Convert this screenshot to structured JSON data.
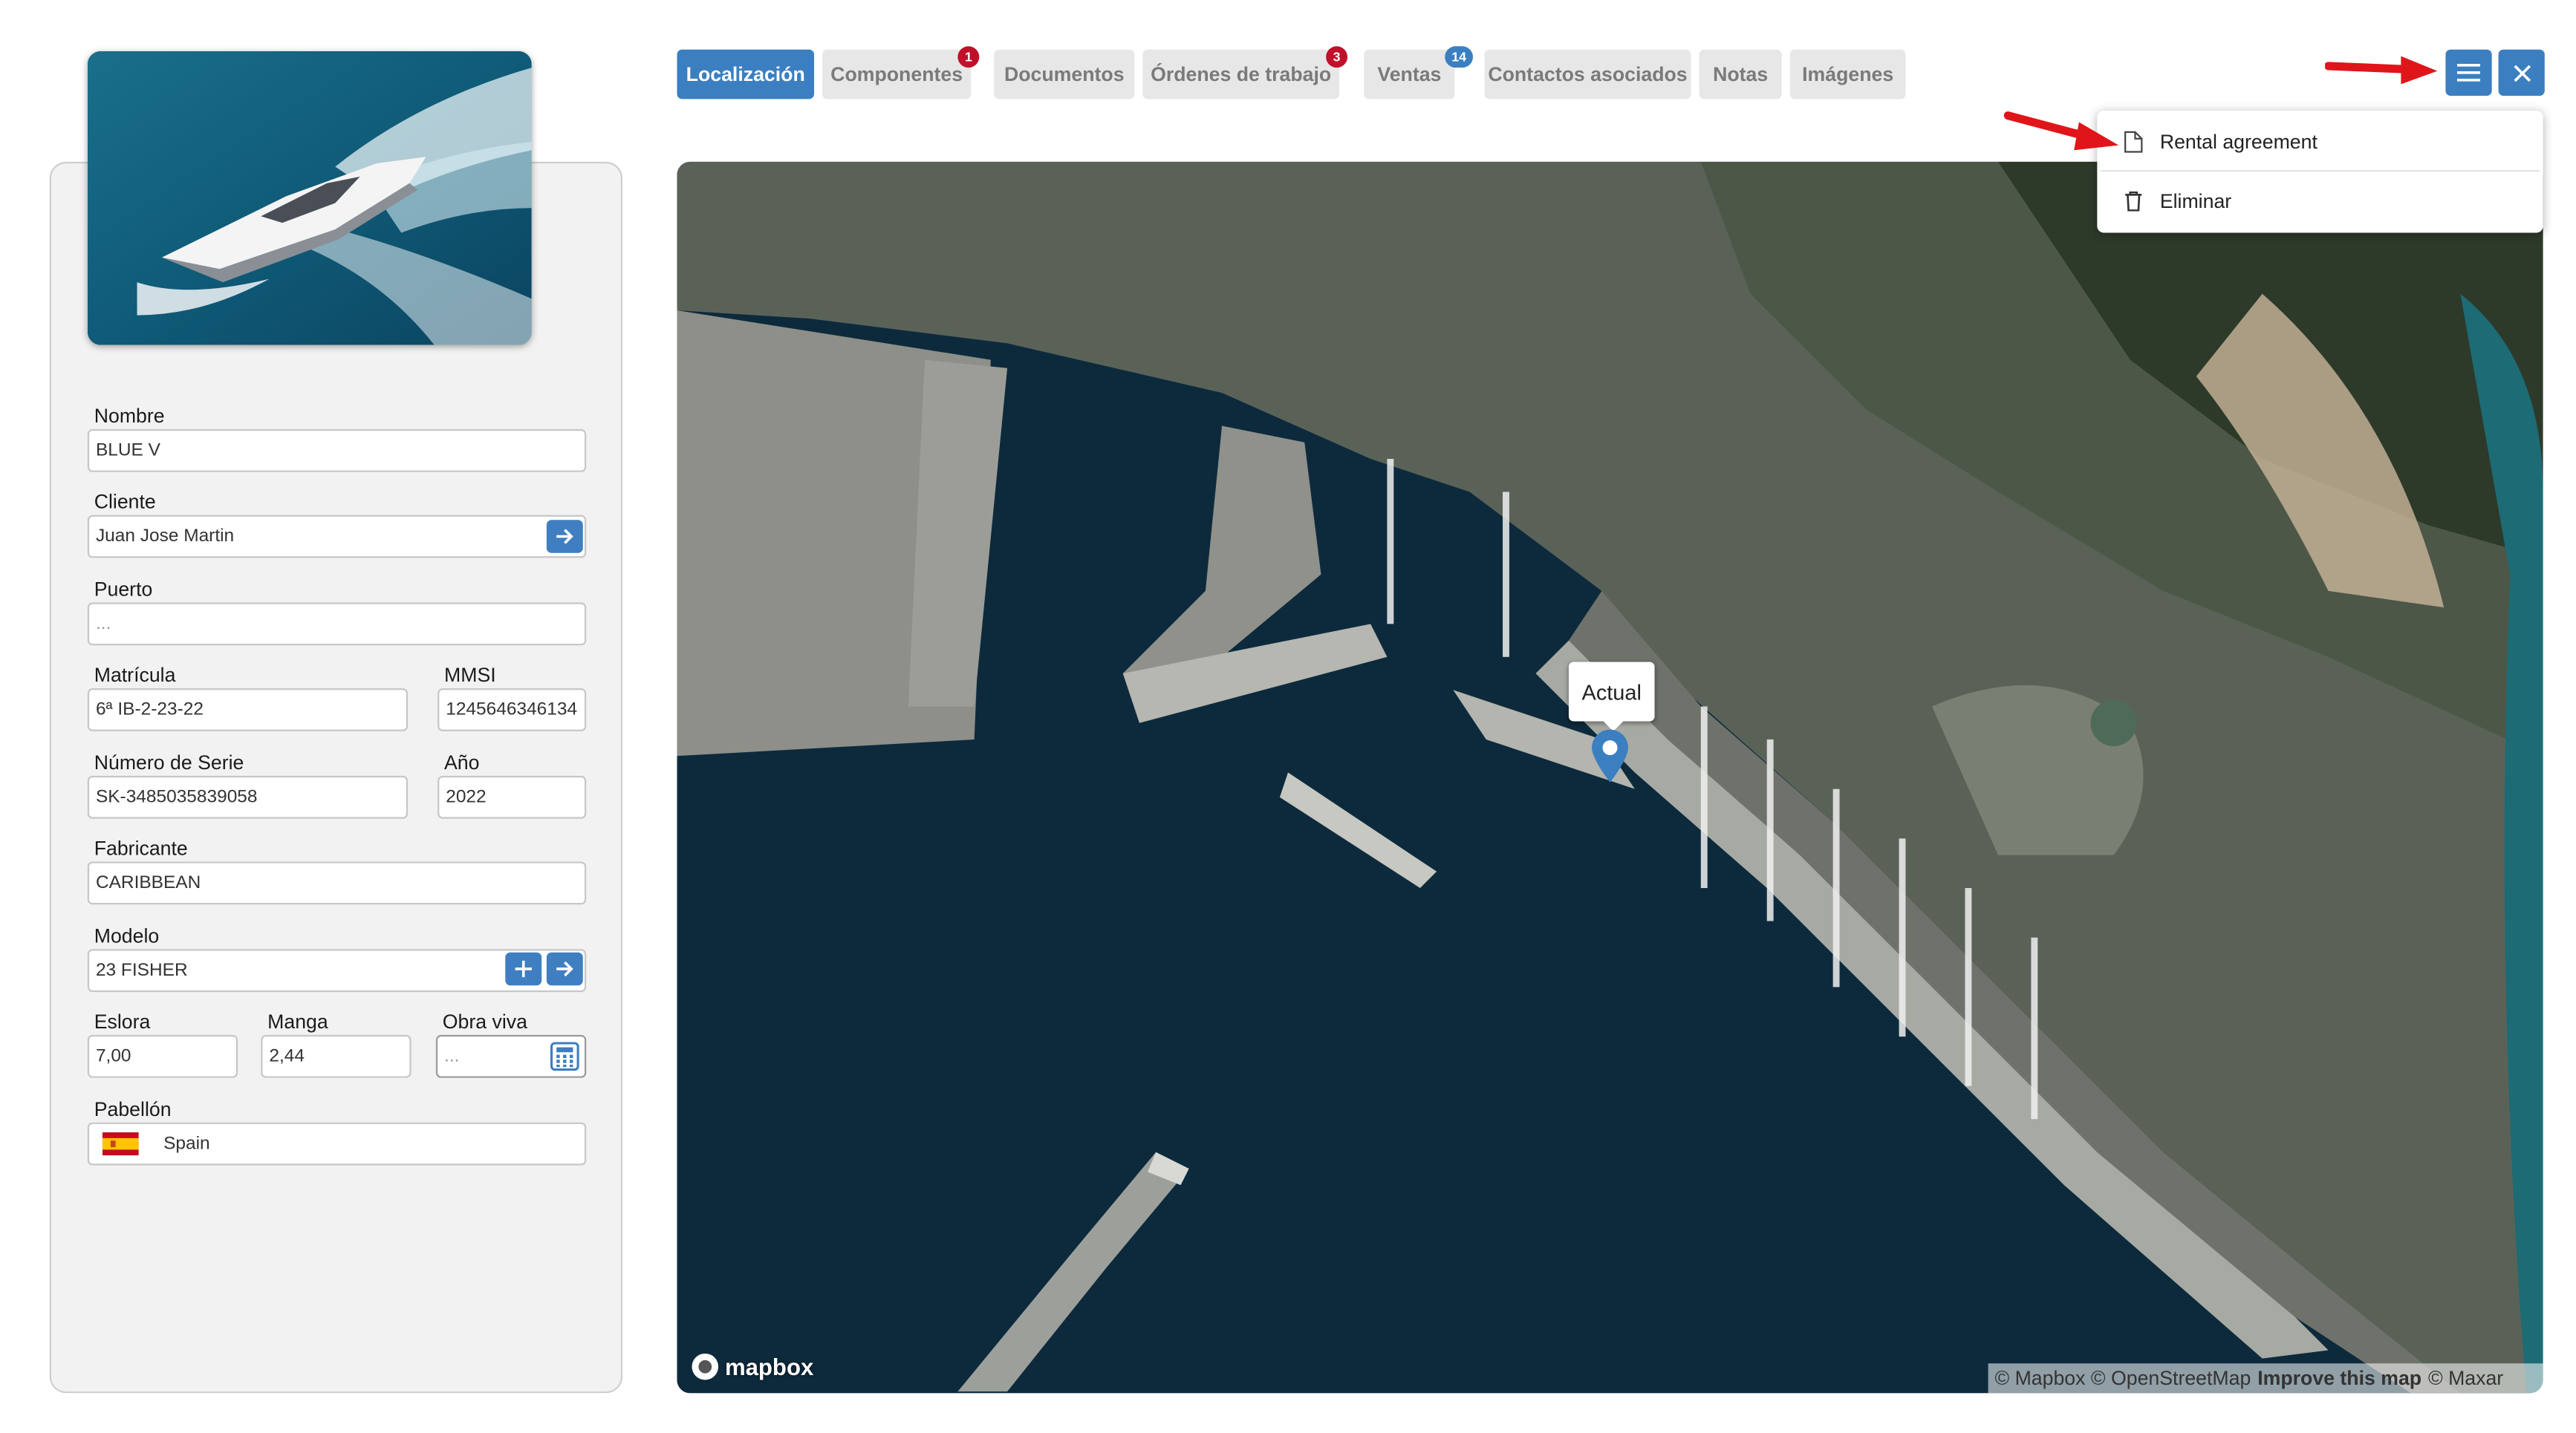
{
  "colors": {
    "accent": "#3c7fc1",
    "badge_red": "#c0102a",
    "annotation_arrow": "#e0151a"
  },
  "tabs": [
    {
      "label": "Localización",
      "active": true
    },
    {
      "label": "Componentes",
      "badge": "1",
      "badge_color": "red"
    },
    {
      "label": "Documentos"
    },
    {
      "label": "Órdenes de trabajo",
      "badge": "3",
      "badge_color": "red"
    },
    {
      "label": "Ventas",
      "badge": "14",
      "badge_color": "blue"
    },
    {
      "label": "Contactos asociados"
    },
    {
      "label": "Notas"
    },
    {
      "label": "Imágenes"
    }
  ],
  "toolbar": {
    "menu_icon": "hamburger-menu-icon",
    "close_icon": "close-icon"
  },
  "dropdown": {
    "items": [
      {
        "label": "Rental agreement",
        "icon": "document-icon"
      },
      {
        "label": "Eliminar",
        "icon": "trash-icon"
      }
    ]
  },
  "form": {
    "nombre": {
      "label": "Nombre",
      "value": "BLUE V"
    },
    "cliente": {
      "label": "Cliente",
      "value": "Juan Jose Martin"
    },
    "puerto": {
      "label": "Puerto",
      "placeholder": "..."
    },
    "matricula": {
      "label": "Matrícula",
      "value": "6ª IB-2-23-22"
    },
    "mmsi": {
      "label": "MMSI",
      "value": "1245646346134"
    },
    "numero_serie": {
      "label": "Número de Serie",
      "value": "SK-3485035839058"
    },
    "anio": {
      "label": "Año",
      "value": "2022"
    },
    "fabricante": {
      "label": "Fabricante",
      "value": "CARIBBEAN"
    },
    "modelo": {
      "label": "Modelo",
      "value": "23 FISHER"
    },
    "eslora": {
      "label": "Eslora",
      "value": "7,00"
    },
    "manga": {
      "label": "Manga",
      "value": "2,44"
    },
    "obra_viva": {
      "label": "Obra viva",
      "placeholder": "..."
    },
    "pabellon": {
      "label": "Pabellón",
      "value": "Spain"
    }
  },
  "map": {
    "marker_label": "Actual",
    "logo_text": "mapbox",
    "attribution": {
      "mapbox": "© Mapbox",
      "osm": "© OpenStreetMap",
      "improve": "Improve this map",
      "maxar": "© Maxar"
    }
  }
}
